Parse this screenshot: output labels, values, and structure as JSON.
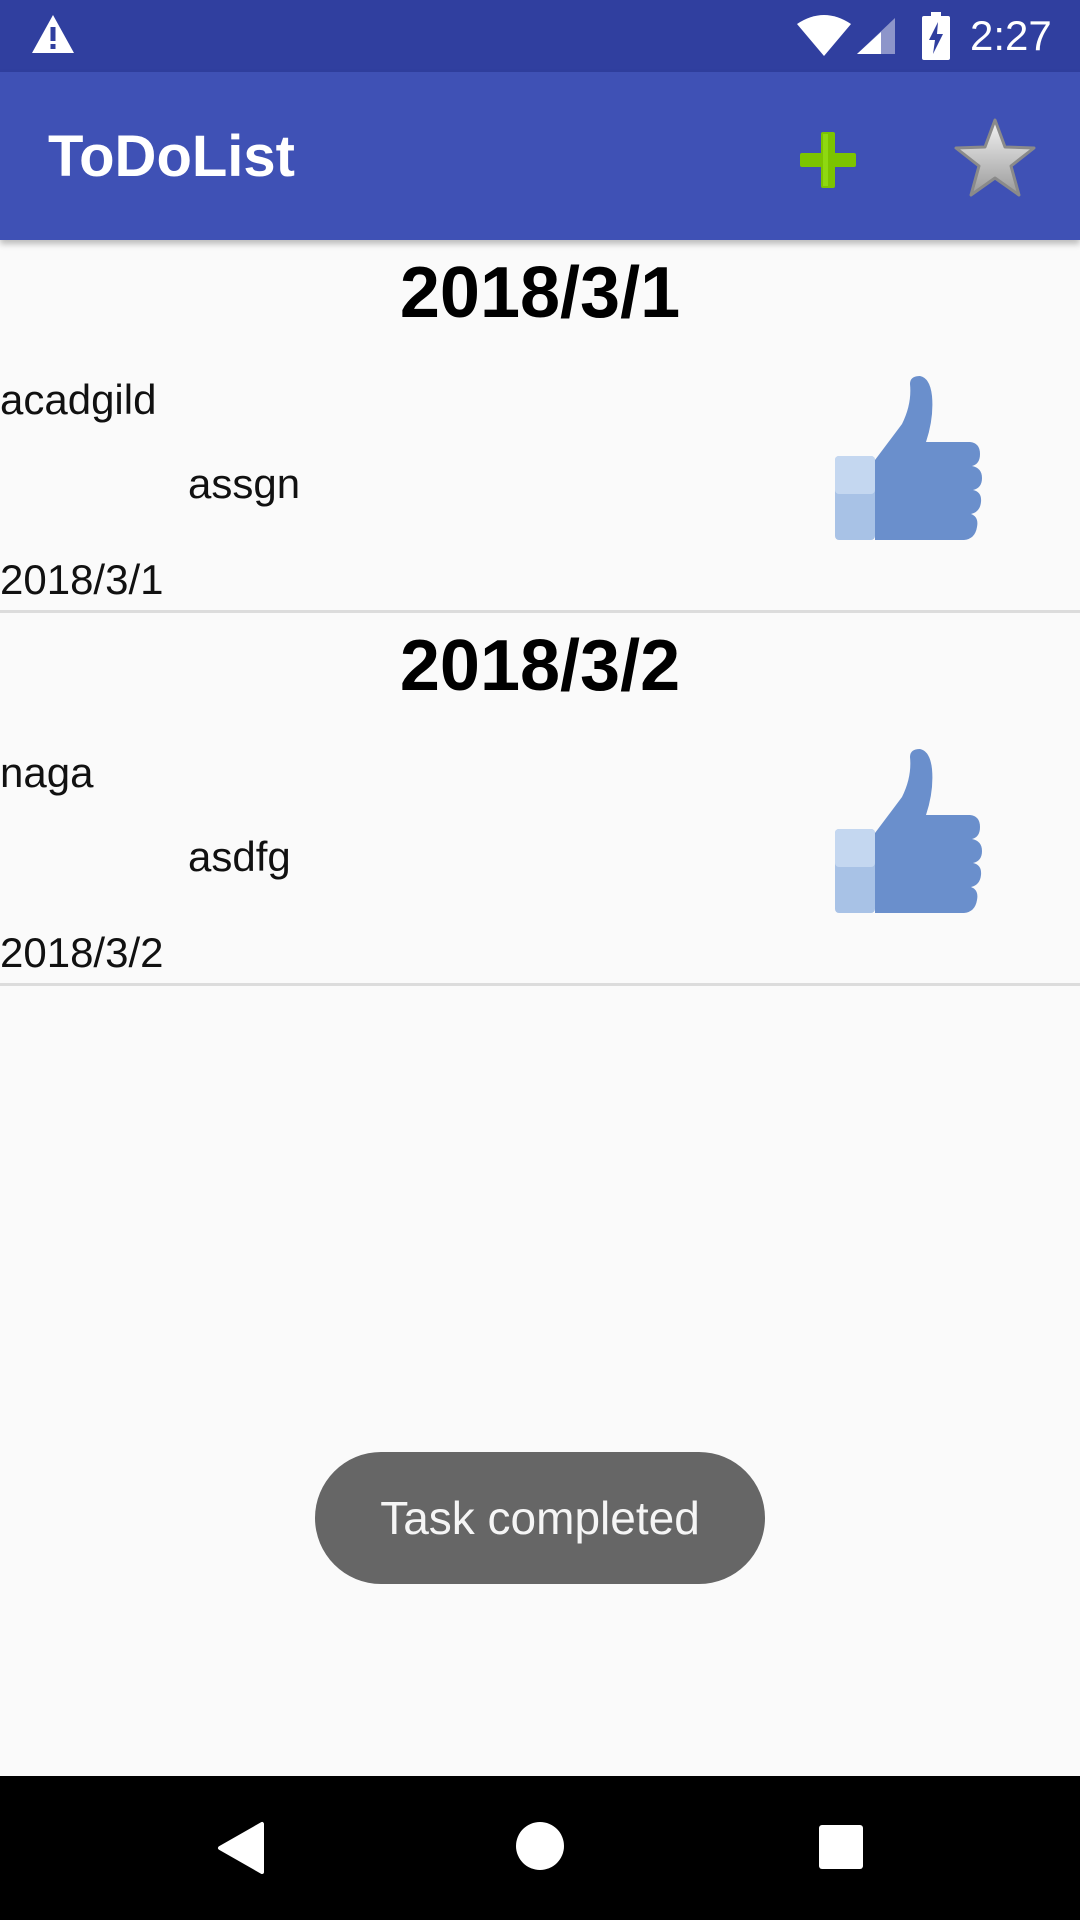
{
  "status_bar": {
    "time": "2:27",
    "icons": [
      "warning-icon",
      "wifi-icon",
      "cell-signal-icon",
      "battery-charging-icon"
    ]
  },
  "app_bar": {
    "title": "ToDoList",
    "actions": [
      "add-icon",
      "star-icon"
    ]
  },
  "tasks": [
    {
      "heading": "2018/3/1",
      "name": "acadgild",
      "description": "assgn",
      "date": "2018/3/1",
      "icon": "thumbs-up-icon"
    },
    {
      "heading": "2018/3/2",
      "name": "naga",
      "description": "asdfg",
      "date": "2018/3/2",
      "icon": "thumbs-up-icon"
    }
  ],
  "toast": {
    "message": "Task completed"
  },
  "nav_bar": {
    "buttons": [
      "back-icon",
      "home-icon",
      "recents-icon"
    ]
  },
  "colors": {
    "status_bar": "#303f9f",
    "app_bar": "#3f51b5",
    "add_icon": "#7cc400",
    "thumb": "#6a8fcc",
    "toast": "#666666",
    "background": "#fafafa"
  }
}
